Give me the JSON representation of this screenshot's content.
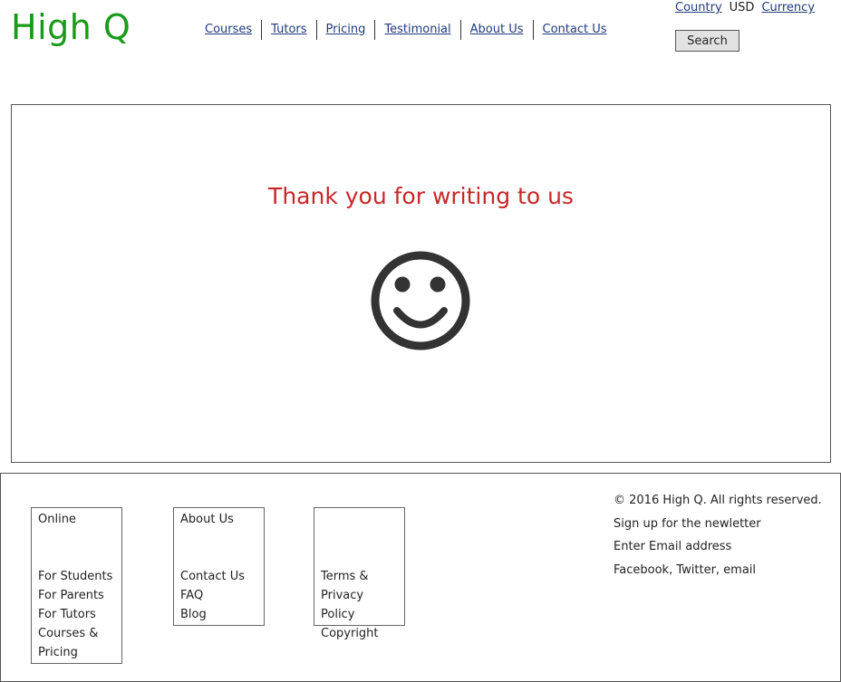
{
  "header": {
    "logo": "High Q",
    "nav": [
      "Courses",
      "Tutors",
      "Pricing",
      "Testimonial",
      "About Us",
      "Contact Us"
    ],
    "country_label": "Country",
    "currency_value": "USD",
    "currency_label": "Currency",
    "search_label": "Search"
  },
  "main": {
    "message": "Thank you for writing to us",
    "icon": "smiley-icon"
  },
  "footer": {
    "col1": {
      "title": "Online",
      "links": [
        "For Students",
        "For Parents",
        "For Tutors",
        "Courses &",
        "Pricing"
      ]
    },
    "col2": {
      "title": "About Us",
      "links": [
        "Contact Us",
        "FAQ",
        "Blog"
      ]
    },
    "col3": {
      "links": [
        "Terms &",
        "Privacy Policy",
        "Copyright"
      ]
    },
    "info": {
      "copyright": "© 2016 High Q. All rights reserved.",
      "newsletter": "Sign up for the newletter",
      "email": "Enter Email address",
      "social": "Facebook, Twitter, email"
    }
  }
}
